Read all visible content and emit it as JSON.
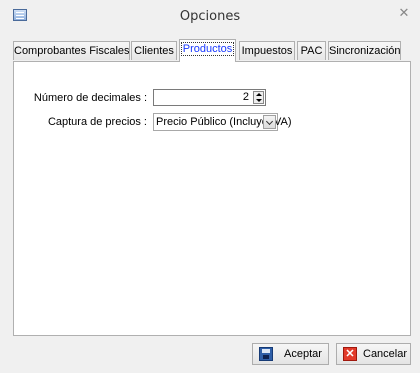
{
  "window": {
    "title": "Opciones",
    "close_glyph": "✕"
  },
  "tabs": [
    {
      "label": "Comprobantes Fiscales",
      "active": false
    },
    {
      "label": "Clientes",
      "active": false
    },
    {
      "label": "Productos",
      "active": true
    },
    {
      "label": "Impuestos",
      "active": false
    },
    {
      "label": "PAC",
      "active": false
    },
    {
      "label": "Sincronización",
      "active": false
    }
  ],
  "form": {
    "decimales_label": "Número de decimales :",
    "decimales_value": "2",
    "captura_label": "Captura de precios :",
    "captura_value": "Precio Público (Incluye IVA)"
  },
  "buttons": {
    "accept": "Aceptar",
    "cancel": "Cancelar",
    "cancel_glyph": "✕"
  }
}
